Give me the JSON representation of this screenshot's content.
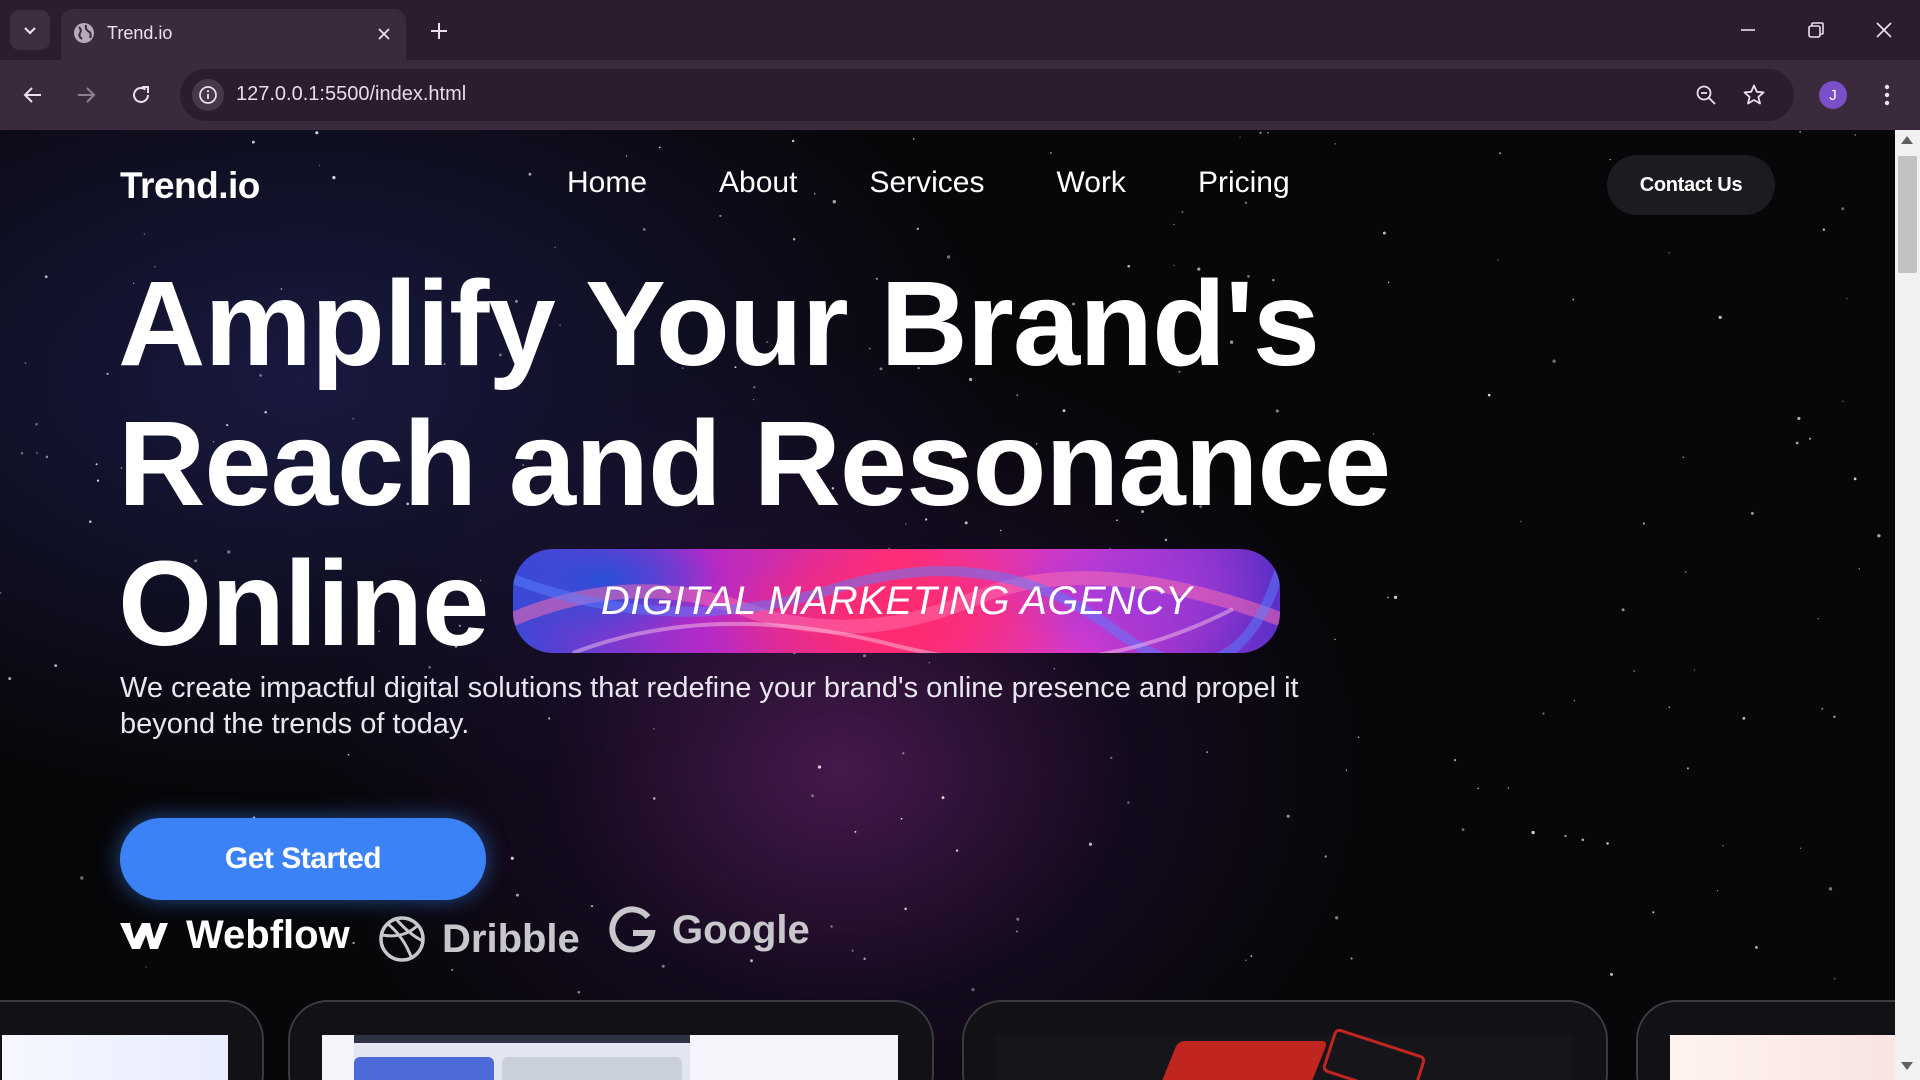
{
  "browser": {
    "tab_title": "Trend.io",
    "url": "127.0.0.1:5500/index.html",
    "profile_initial": "J",
    "icons": [
      "tab-search-icon",
      "globe-icon",
      "close-icon",
      "plus-icon",
      "minimize-icon",
      "restore-icon",
      "close-window-icon",
      "back-icon",
      "forward-icon",
      "reload-icon",
      "site-info-icon",
      "zoom-icon",
      "star-icon",
      "more-icon"
    ]
  },
  "site": {
    "logo": "Trend.io",
    "nav": [
      "Home",
      "About",
      "Services",
      "Work",
      "Pricing"
    ],
    "contact_label": "Contact Us",
    "headline": {
      "line1": "Amplify Your Brand's",
      "line2": "Reach and Resonance",
      "line3": "Online"
    },
    "badge": "DIGITAL MARKETING AGENCY",
    "description": "We create impactful digital solutions that redefine your brand's online presence and propel it beyond the trends of today.",
    "cta_label": "Get Started",
    "partners": [
      {
        "name": "Webflow",
        "icon": "webflow-icon"
      },
      {
        "name": "Dribble",
        "icon": "dribbble-icon"
      },
      {
        "name": "Google",
        "icon": "google-icon"
      }
    ]
  },
  "colors": {
    "accent": "#3b82f6",
    "chrome_dark": "#2b1d2e",
    "chrome_light": "#3a2a3c",
    "page_bg": "#07070a"
  }
}
